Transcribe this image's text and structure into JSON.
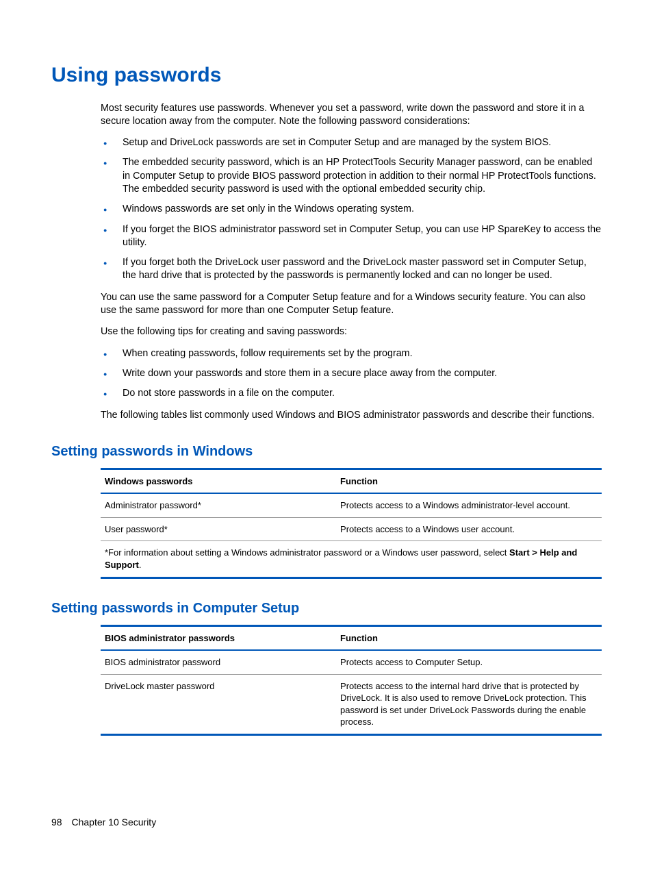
{
  "heading": "Using passwords",
  "para1": "Most security features use passwords. Whenever you set a password, write down the password and store it in a secure location away from the computer. Note the following password considerations:",
  "bullets1": [
    "Setup and DriveLock passwords are set in Computer Setup and are managed by the system BIOS.",
    "The embedded security password, which is an HP ProtectTools Security Manager password, can be enabled in Computer Setup to provide BIOS password protection in addition to their normal HP ProtectTools functions. The embedded security password is used with the optional embedded security chip.",
    "Windows passwords are set only in the Windows operating system.",
    "If you forget the BIOS administrator password set in Computer Setup, you can use HP SpareKey to access the utility.",
    "If you forget both the DriveLock user password and the DriveLock master password set in Computer Setup, the hard drive that is protected by the passwords is permanently locked and can no longer be used."
  ],
  "para2": "You can use the same password for a Computer Setup feature and for a Windows security feature. You can also use the same password for more than one Computer Setup feature.",
  "para3": "Use the following tips for creating and saving passwords:",
  "bullets2": [
    "When creating passwords, follow requirements set by the program.",
    "Write down your passwords and store them in a secure place away from the computer.",
    "Do not store passwords in a file on the computer."
  ],
  "para4": "The following tables list commonly used Windows and BIOS administrator passwords and describe their functions.",
  "sub1": "Setting passwords in Windows",
  "table1": {
    "head1": "Windows passwords",
    "head2": "Function",
    "rows": [
      {
        "c1": "Administrator password*",
        "c2": "Protects access to a Windows administrator-level account."
      },
      {
        "c1": "User password*",
        "c2": "Protects access to a Windows user account."
      }
    ],
    "foot_prefix": "*For information about setting a Windows administrator password or a Windows user password, select ",
    "foot_bold": "Start > Help and Support",
    "foot_suffix": "."
  },
  "sub2": "Setting passwords in Computer Setup",
  "table2": {
    "head1": "BIOS administrator passwords",
    "head2": "Function",
    "rows": [
      {
        "c1": "BIOS administrator password",
        "c2": "Protects access to Computer Setup."
      },
      {
        "c1": "DriveLock master password",
        "c2": "Protects access to the internal hard drive that is protected by DriveLock. It is also used to remove DriveLock protection. This password is set under DriveLock Passwords during the enable process."
      }
    ]
  },
  "footer": {
    "page": "98",
    "chapter": "Chapter 10   Security"
  }
}
